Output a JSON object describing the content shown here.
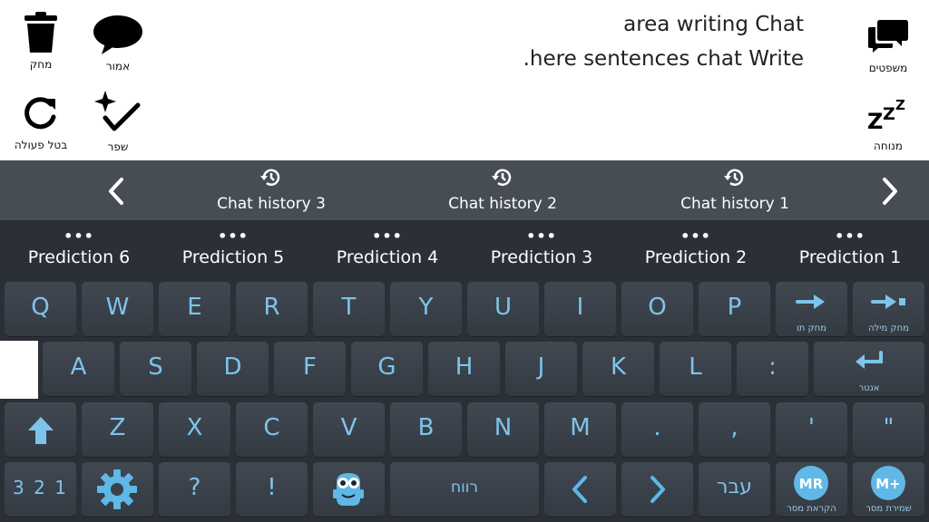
{
  "toolbar": {
    "delete_label": "מחק",
    "say_label": "אמור",
    "undo_label": "בטל פעולה",
    "improve_label": "שפר",
    "sentences_label": "משפטים",
    "rest_label": "מנוחה"
  },
  "chat": {
    "line1": "area writing Chat",
    "line2": ".here sentences chat Write"
  },
  "history": {
    "items": [
      "Chat history 3",
      "Chat history 2",
      "Chat history 1"
    ]
  },
  "predictions": {
    "items": [
      "Prediction 6",
      "Prediction 5",
      "Prediction 4",
      "Prediction 3",
      "Prediction 2",
      "Prediction 1"
    ],
    "dots": "•••"
  },
  "keyboard": {
    "row1": [
      "Q",
      "W",
      "E",
      "R",
      "T",
      "Y",
      "U",
      "I",
      "O",
      "P"
    ],
    "row2": [
      "A",
      "S",
      "D",
      "F",
      "G",
      "H",
      "J",
      "K",
      "L",
      ":"
    ],
    "row3": [
      "Z",
      "X",
      "C",
      "V",
      "B",
      "N",
      "M",
      ".",
      ",",
      "'",
      "\""
    ],
    "delete_char_label": "מחק תו",
    "delete_word_label": "מחק מילה",
    "enter_label": "אנטר",
    "numbers_label": "3 2 1",
    "question": "?",
    "exclaim": "!",
    "space_label": "רווח",
    "language_label": "עבר",
    "mr_icon_text": "MR",
    "mr_label": "הקראת מסר",
    "mplus_icon_text": "M+",
    "mplus_label": "שמירת מסר"
  },
  "colors": {
    "key_text": "#7ec4ea",
    "key_bg": "#3b414a",
    "keyboard_bg": "#2b3037",
    "history_bg": "#474d55",
    "accent": "#5fb8e6"
  }
}
